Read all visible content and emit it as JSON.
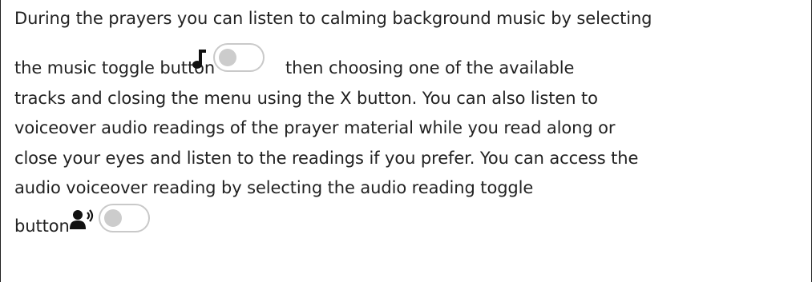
{
  "instructions": {
    "line1": "During the prayers you can listen to calming background music by selecting",
    "line2a": "the music toggle button",
    "line2b": "then choosing one of the available",
    "line3": "tracks and closing the menu using the X button. You can also listen to",
    "line4": "voiceover audio readings of the prayer material while you read along or",
    "line5": "close your eyes and listen to the readings if you prefer. You can access the",
    "line6": "audio voiceover reading by selecting the audio reading toggle",
    "line7": "button"
  },
  "music_toggle": {
    "icon": "music-note-icon",
    "state": "off"
  },
  "audio_toggle": {
    "icon": "voiceover-speaker-icon",
    "state": "off"
  },
  "colors": {
    "text": "#222222",
    "toggle_border": "#c9c9c9",
    "toggle_knob": "#cccccc",
    "icon": "#111111"
  }
}
